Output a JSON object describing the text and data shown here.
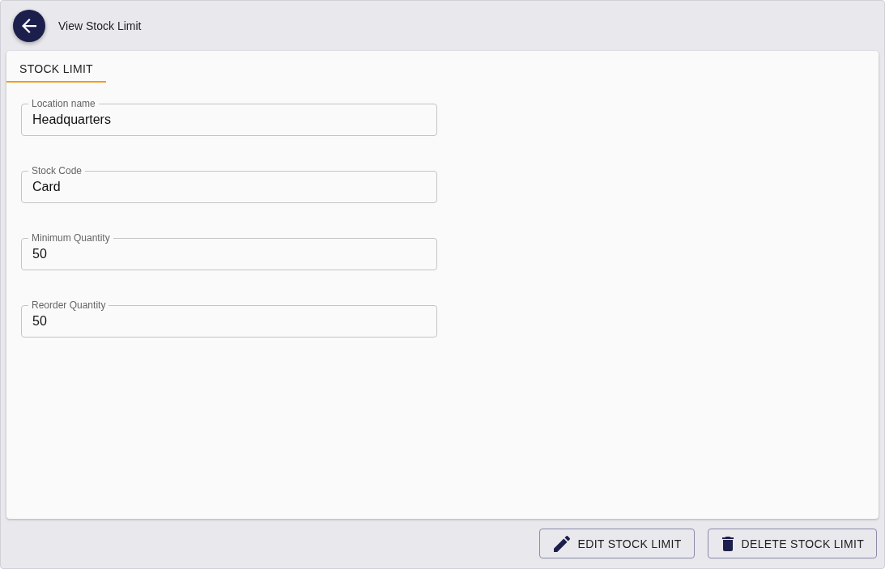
{
  "header": {
    "title": "View Stock Limit"
  },
  "tabs": [
    {
      "label": "STOCK LIMIT",
      "selected": true
    }
  ],
  "fields": [
    {
      "label": "Location name",
      "value": "Headquarters"
    },
    {
      "label": "Stock Code",
      "value": "Card"
    },
    {
      "label": "Minimum Quantity",
      "value": "50"
    },
    {
      "label": "Reorder Quantity",
      "value": "50"
    }
  ],
  "buttons": [
    {
      "label": "EDIT STOCK LIMIT",
      "kind": "edit"
    },
    {
      "label": "DELETE STOCK LIMIT",
      "kind": "delete"
    }
  ]
}
